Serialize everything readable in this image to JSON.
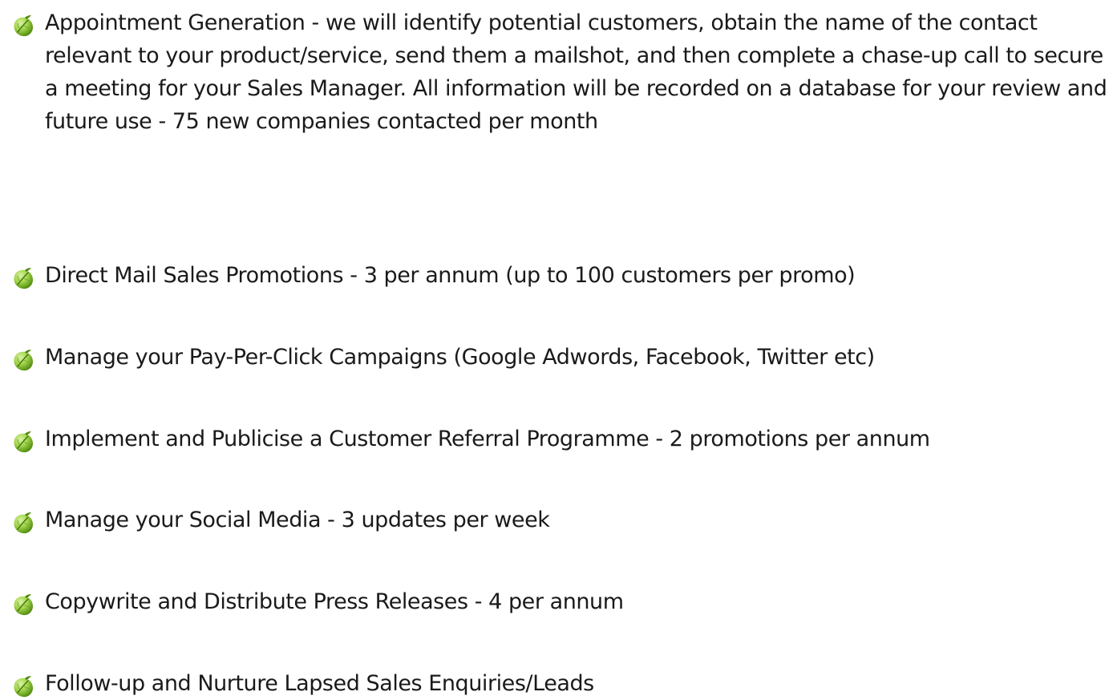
{
  "bullet_icon": "green-leaf-icon",
  "colors": {
    "text": "#1a1a1a",
    "leaf_dark": "#4f8a0e",
    "leaf_light": "#a6d84e",
    "leaf_highlight": "#d9f0a8"
  },
  "items": [
    {
      "label": "Appointment Generation - we will identify potential customers, obtain the name of the contact relevant to your product/service, send them a mailshot, and then complete a chase-up call to secure a meeting for your Sales Manager.  All information will be recorded on a database for your review and future use - 75 new companies contacted per month"
    },
    {
      "label": "Direct Mail Sales Promotions - 3 per annum (up to 100 customers per promo)"
    },
    {
      "label": "Manage your Pay-Per-Click Campaigns (Google Adwords, Facebook, Twitter etc)"
    },
    {
      "label": "Implement and Publicise a Customer Referral Programme - 2 promotions per annum"
    },
    {
      "label": "Manage your Social Media - 3 updates per week"
    },
    {
      "label": "Copywrite and Distribute Press Releases - 4 per annum"
    },
    {
      "label": "Follow-up and Nurture Lapsed Sales Enquiries/Leads"
    }
  ]
}
